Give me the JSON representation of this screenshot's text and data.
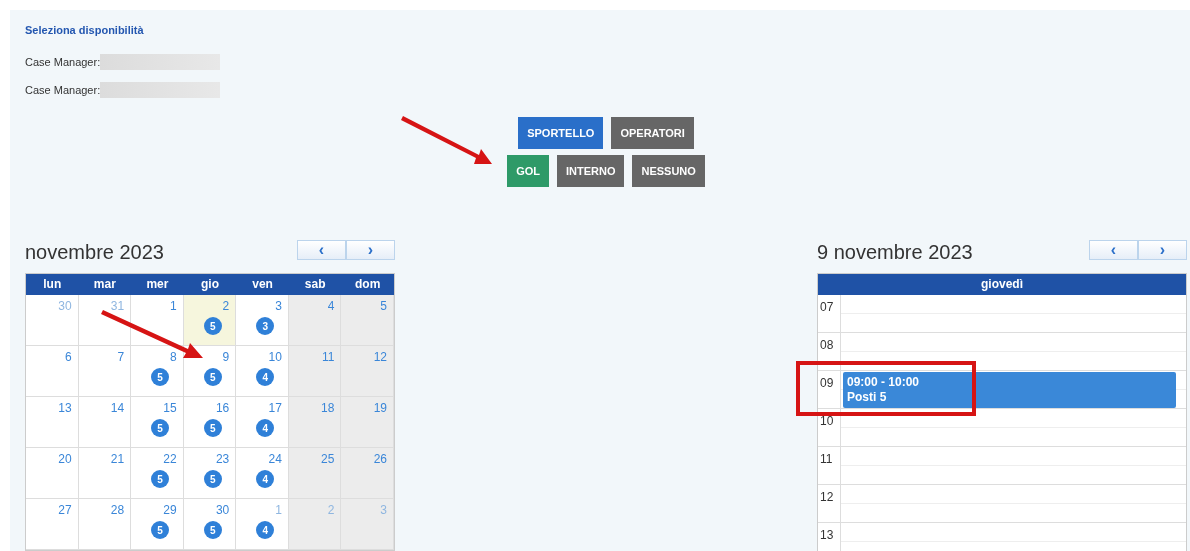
{
  "panel": {
    "title": "Seleziona disponibilità",
    "managers": [
      {
        "label": "Case Manager:"
      },
      {
        "label": "Case Manager:"
      }
    ]
  },
  "mode_buttons": [
    [
      {
        "label": "SPORTELLO",
        "color": "#2a6fc9"
      },
      {
        "label": "OPERATORI",
        "color": "#666666"
      }
    ],
    [
      {
        "label": "GOL",
        "color": "#2e9a68"
      },
      {
        "label": "INTERNO",
        "color": "#666666"
      },
      {
        "label": "NESSUNO",
        "color": "#666666"
      }
    ]
  ],
  "month_calendar": {
    "title": "novembre 2023",
    "prev": "‹",
    "next": "›",
    "weekdays": [
      {
        "label": "lun",
        "weekend": false
      },
      {
        "label": "mar",
        "weekend": false
      },
      {
        "label": "mer",
        "weekend": false
      },
      {
        "label": "gio",
        "weekend": false
      },
      {
        "label": "ven",
        "weekend": false
      },
      {
        "label": "sab",
        "weekend": true
      },
      {
        "label": "dom",
        "weekend": true
      }
    ],
    "weeks": [
      [
        {
          "day": "30",
          "other_month": true,
          "today": false
        },
        {
          "day": "31",
          "other_month": true,
          "today": false
        },
        {
          "day": "1",
          "other_month": false,
          "today": false
        },
        {
          "day": "2",
          "other_month": false,
          "today": true,
          "count": "5"
        },
        {
          "day": "3",
          "other_month": false,
          "today": false,
          "count": "3"
        },
        {
          "day": "4",
          "other_month": false,
          "today": false
        },
        {
          "day": "5",
          "other_month": false,
          "today": false
        }
      ],
      [
        {
          "day": "6",
          "other_month": false,
          "today": false
        },
        {
          "day": "7",
          "other_month": false,
          "today": false
        },
        {
          "day": "8",
          "other_month": false,
          "today": false,
          "count": "5"
        },
        {
          "day": "9",
          "other_month": false,
          "today": false,
          "count": "5"
        },
        {
          "day": "10",
          "other_month": false,
          "today": false,
          "count": "4"
        },
        {
          "day": "11",
          "other_month": false,
          "today": false
        },
        {
          "day": "12",
          "other_month": false,
          "today": false
        }
      ],
      [
        {
          "day": "13",
          "other_month": false,
          "today": false
        },
        {
          "day": "14",
          "other_month": false,
          "today": false
        },
        {
          "day": "15",
          "other_month": false,
          "today": false,
          "count": "5"
        },
        {
          "day": "16",
          "other_month": false,
          "today": false,
          "count": "5"
        },
        {
          "day": "17",
          "other_month": false,
          "today": false,
          "count": "4"
        },
        {
          "day": "18",
          "other_month": false,
          "today": false
        },
        {
          "day": "19",
          "other_month": false,
          "today": false
        }
      ],
      [
        {
          "day": "20",
          "other_month": false,
          "today": false
        },
        {
          "day": "21",
          "other_month": false,
          "today": false
        },
        {
          "day": "22",
          "other_month": false,
          "today": false,
          "count": "5"
        },
        {
          "day": "23",
          "other_month": false,
          "today": false,
          "count": "5"
        },
        {
          "day": "24",
          "other_month": false,
          "today": false,
          "count": "4"
        },
        {
          "day": "25",
          "other_month": false,
          "today": false
        },
        {
          "day": "26",
          "other_month": false,
          "today": false
        }
      ],
      [
        {
          "day": "27",
          "other_month": false,
          "today": false
        },
        {
          "day": "28",
          "other_month": false,
          "today": false
        },
        {
          "day": "29",
          "other_month": false,
          "today": false,
          "count": "5"
        },
        {
          "day": "30",
          "other_month": false,
          "today": false,
          "count": "5"
        },
        {
          "day": "1",
          "other_month": true,
          "today": false,
          "count": "4"
        },
        {
          "day": "2",
          "other_month": true,
          "today": false
        },
        {
          "day": "3",
          "other_month": true,
          "today": false
        }
      ]
    ]
  },
  "day_calendar": {
    "title": "9 novembre 2023",
    "prev": "‹",
    "next": "›",
    "day_header": "giovedì",
    "hours": [
      {
        "label": "07"
      },
      {
        "label": "08"
      },
      {
        "label": "09",
        "event": {
          "time": "09:00 - 10:00",
          "text": "Posti 5"
        }
      },
      {
        "label": "10"
      },
      {
        "label": "11"
      },
      {
        "label": "12"
      },
      {
        "label": "13"
      }
    ]
  }
}
